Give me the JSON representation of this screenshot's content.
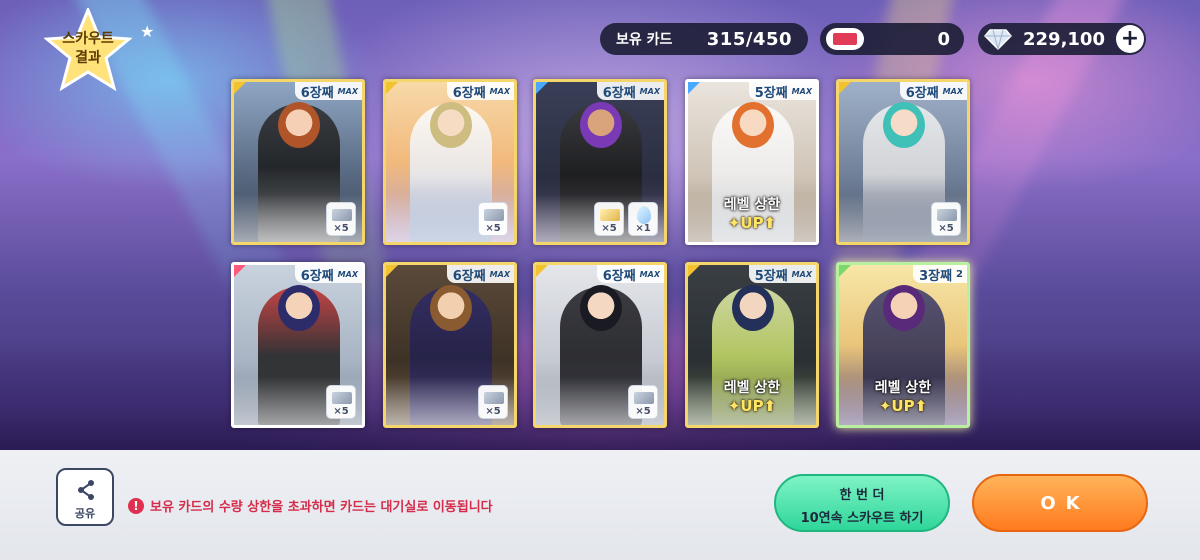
{
  "colors": {
    "accent_green": "#2fd69a",
    "accent_orange": "#ff7a1e",
    "warning_red": "#d42c4a",
    "pill_bg": "#1e2038"
  },
  "header": {
    "title_line1": "스카우트",
    "title_line2": "결과",
    "owned_cards_label": "보유 카드",
    "owned_cards_value": "315/450",
    "tickets_value": "0",
    "gems_value": "229,100",
    "plus_label": "+"
  },
  "cards": [
    {
      "gen": "6장째",
      "badge": "MAX",
      "rarity": "gold",
      "items": [
        {
          "type": "silver-ticket",
          "count": "×5"
        }
      ]
    },
    {
      "gen": "6장째",
      "badge": "MAX",
      "rarity": "gold",
      "items": [
        {
          "type": "silver-ticket",
          "count": "×5"
        }
      ]
    },
    {
      "gen": "6장째",
      "badge": "MAX",
      "rarity": "blue",
      "items": [
        {
          "type": "gold-ticket",
          "count": "×5"
        },
        {
          "type": "crystal-drop",
          "count": "×1"
        }
      ]
    },
    {
      "gen": "5장째",
      "badge": "MAX",
      "rarity": "blue",
      "level_cap": "레벨 상한",
      "level_up": "✦UP⬆"
    },
    {
      "gen": "6장째",
      "badge": "MAX",
      "rarity": "gold",
      "items": [
        {
          "type": "silver-ticket",
          "count": "×5"
        }
      ]
    },
    {
      "gen": "6장째",
      "badge": "MAX",
      "rarity": "red",
      "items": [
        {
          "type": "silver-ticket",
          "count": "×5"
        }
      ]
    },
    {
      "gen": "6장째",
      "badge": "MAX",
      "rarity": "gold",
      "items": [
        {
          "type": "silver-ticket",
          "count": "×5"
        }
      ]
    },
    {
      "gen": "6장째",
      "badge": "MAX",
      "rarity": "gold",
      "items": [
        {
          "type": "silver-ticket",
          "count": "×5"
        }
      ]
    },
    {
      "gen": "5장째",
      "badge": "MAX",
      "rarity": "gold",
      "level_cap": "레벨 상한",
      "level_up": "✦UP⬆"
    },
    {
      "gen": "3장째",
      "badge": "2",
      "rarity": "green",
      "level_cap": "레벨 상한",
      "level_up": "✦UP⬆"
    }
  ],
  "footer": {
    "share_label": "공유",
    "warning_icon": "!",
    "warning_text": "보유 카드의 수량 상한을 초과하면 카드는 대기실로 이동됩니다",
    "again_line1": "한 번 더",
    "again_line2": "10연속 스카우트 하기",
    "ok_label": "OK"
  }
}
